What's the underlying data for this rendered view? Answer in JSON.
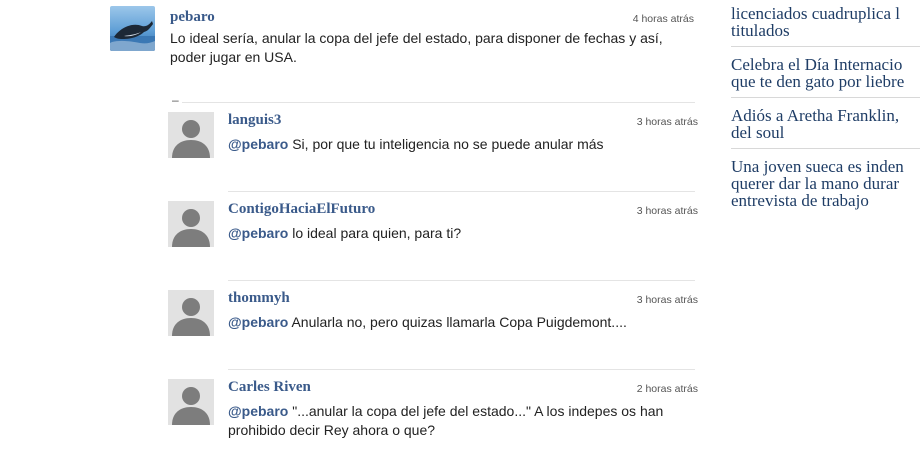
{
  "main_comment": {
    "author": "pebaro",
    "time": "4 horas atrás",
    "text": "Lo ideal sería, anular la copa del jefe del estado, para disponer de fechas y así, poder jugar en USA.",
    "collapse_symbol": "–"
  },
  "replies": [
    {
      "author": "languis3",
      "time": "3 horas atrás",
      "mention": "@pebaro",
      "text": " Si, por que tu inteligencia no se puede anular más"
    },
    {
      "author": "ContigoHaciaElFuturo",
      "time": "3 horas atrás",
      "mention": "@pebaro",
      "text": " lo ideal para quien, para ti?"
    },
    {
      "author": "thommyh",
      "time": "3 horas atrás",
      "mention": "@pebaro",
      "text": " Anularla no, pero quizas llamarla Copa Puigdemont...."
    },
    {
      "author": "Carles Riven",
      "time": "2 horas atrás",
      "mention": "@pebaro",
      "text": " \"...anular la copa del jefe del estado...\" A los indepes os han prohibido decir Rey ahora o que?"
    }
  ],
  "sidebar": {
    "items": [
      {
        "line1": "licenciados cuadruplica l",
        "line2": "titulados"
      },
      {
        "line1": "Celebra el Día Internacio",
        "line2": "que te den gato por liebre"
      },
      {
        "line1": "Adiós a Aretha Franklin, ",
        "line2": "del soul"
      },
      {
        "line1": "Una joven sueca es inden",
        "line2": "querer dar la mano durar",
        "line3": "entrevista de trabajo"
      }
    ]
  },
  "colors": {
    "author": "#3a5a8a",
    "sidebar_link": "#1f3d66",
    "separator": "#e4e4e4",
    "avatar_placeholder": "#e2e2e2"
  },
  "icons": {
    "main_avatar": "whale-photo-avatar",
    "reply_avatar": "default-user-avatar"
  }
}
